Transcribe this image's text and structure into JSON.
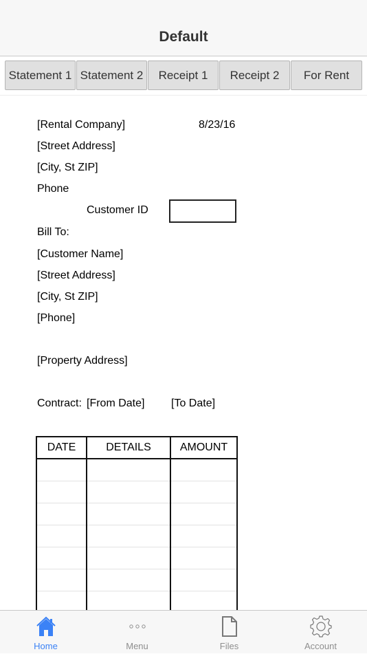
{
  "nav": {
    "title": "Default"
  },
  "tabs": [
    {
      "label": "Statement 1"
    },
    {
      "label": "Statement 2"
    },
    {
      "label": "Receipt 1"
    },
    {
      "label": "Receipt 2"
    },
    {
      "label": "For Rent"
    }
  ],
  "document": {
    "company": "[Rental Company]",
    "date": "8/23/16",
    "company_street": "[Street Address]",
    "company_city": "[City, St ZIP]",
    "company_phone": "Phone",
    "customer_id_label": "Customer ID",
    "customer_id_value": "",
    "bill_to_label": "Bill To:",
    "customer_name": "[Customer Name]",
    "customer_street": "[Street Address]",
    "customer_city": "[City, St ZIP]",
    "customer_phone": "[Phone]",
    "property_address": "[Property Address]",
    "contract_label": "Contract:",
    "from_date": "[From Date]",
    "to_date": "[To Date]",
    "table": {
      "headers": [
        "DATE",
        "DETAILS",
        "AMOUNT"
      ],
      "rows": [
        [
          "",
          "",
          ""
        ],
        [
          "",
          "",
          ""
        ],
        [
          "",
          "",
          ""
        ],
        [
          "",
          "",
          ""
        ],
        [
          "",
          "",
          ""
        ],
        [
          "",
          "",
          ""
        ],
        [
          "",
          "",
          ""
        ]
      ]
    }
  },
  "bottom_tabs": [
    {
      "label": "Home",
      "icon": "home-icon",
      "active": true
    },
    {
      "label": "Menu",
      "icon": "more-icon",
      "active": false
    },
    {
      "label": "Files",
      "icon": "file-icon",
      "active": false
    },
    {
      "label": "Account",
      "icon": "gear-icon",
      "active": false
    }
  ],
  "colors": {
    "accent": "#3b82f6",
    "inactive": "#8e8e8e"
  }
}
